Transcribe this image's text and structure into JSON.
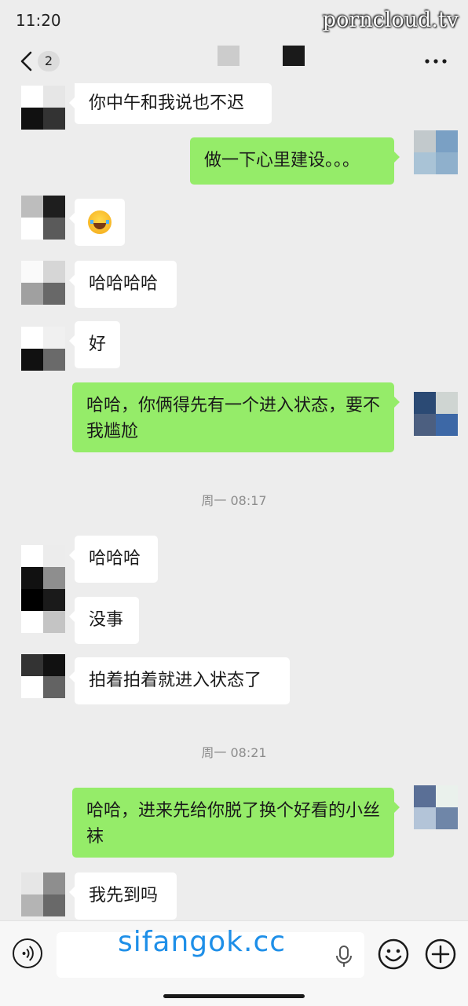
{
  "status_bar": {
    "time": "11:20",
    "watermark": "porncloud.tv"
  },
  "nav": {
    "unread_count": "2",
    "title_blocks": [
      "#cccccc",
      "#1a1a1a"
    ]
  },
  "messages": [
    {
      "side": "in",
      "text": "你中午和我说也不迟",
      "avatar": [
        "#ffffff",
        "#e6e6e6",
        "#111111",
        "#333333"
      ]
    },
    {
      "side": "out",
      "text": "做一下心里建设。。。",
      "avatar": [
        "#c2c9cc",
        "#7aa0c4",
        "#a9c3d6",
        "#8fb0cc"
      ]
    },
    {
      "side": "in",
      "emoji": "grinning-squinting-tears-emoji",
      "avatar": [
        "#bdbdbd",
        "#1e1e1e",
        "#ffffff",
        "#5a5a5a"
      ]
    },
    {
      "side": "in",
      "text": "哈哈哈哈",
      "avatar": [
        "#fafafa",
        "#d6d6d6",
        "#a0a0a0",
        "#686868"
      ]
    },
    {
      "side": "in",
      "text": "好",
      "avatar": [
        "#ffffff",
        "#f0f0f0",
        "#111111",
        "#6a6a6a"
      ]
    },
    {
      "side": "out",
      "text": "哈哈，你俩得先有一个进入状态，要不我尴尬",
      "avatar": [
        "#2b4a74",
        "#cfd5d2",
        "#4c5f80",
        "#3d68a6"
      ]
    },
    {
      "kind": "time",
      "text": "周一 08:17"
    },
    {
      "side": "in",
      "text": "哈哈哈",
      "avatar": [
        "#ffffff",
        "#ececec",
        "#111111",
        "#8e8e8e"
      ]
    },
    {
      "side": "in",
      "text": "没事",
      "avatar": [
        "#000000",
        "#1a1a1a",
        "#ffffff",
        "#c4c4c4"
      ]
    },
    {
      "side": "in",
      "text": "拍着拍着就进入状态了",
      "avatar": [
        "#333333",
        "#111111",
        "#ffffff",
        "#636363"
      ]
    },
    {
      "kind": "time",
      "text": "周一 08:21"
    },
    {
      "side": "out",
      "text": "哈哈，进来先给你脱了换个好看的小丝袜",
      "avatar": [
        "#5a6f96",
        "#eaf1ec",
        "#b3c4d8",
        "#6f86a8"
      ]
    },
    {
      "side": "in",
      "text": "我先到吗",
      "avatar": [
        "#e6e6e6",
        "#8e8e8e",
        "#b4b4b4",
        "#696969"
      ]
    }
  ],
  "input_bar": {
    "placeholder": "",
    "watermark": "sifangok.cc"
  }
}
